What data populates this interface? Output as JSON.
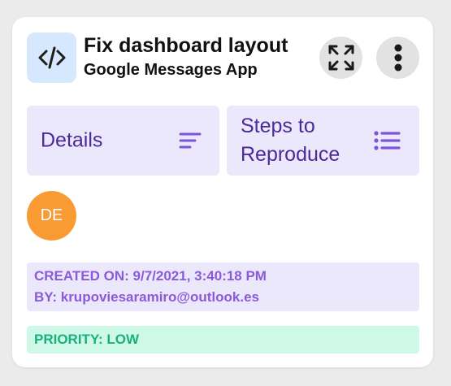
{
  "card": {
    "title": "Fix dashboard layout",
    "subtitle": "Google Messages App",
    "type_icon": "code-icon",
    "expand_icon": "expand-icon",
    "more_icon": "more-vertical-icon"
  },
  "tabs": [
    {
      "label": "Details",
      "icon": "text-align-left-icon"
    },
    {
      "label": "Steps to Reproduce",
      "label_line1": "Steps to",
      "label_line2": "Reproduce",
      "icon": "list-icon"
    }
  ],
  "assignee": {
    "initials": "DE",
    "color": "#f99b32"
  },
  "meta": {
    "created": "CREATED ON: 9/7/2021, 3:40:18 PM",
    "by": "BY: krupoviesaramiro@outlook.es"
  },
  "priority": {
    "text": "PRIORITY: LOW",
    "color": "#1cb07e"
  },
  "colors": {
    "accent": "#4a2a9a",
    "tab_bg": "#ece8fb",
    "meta_text": "#8a5ad9",
    "priority_bg": "#cef8e8"
  }
}
